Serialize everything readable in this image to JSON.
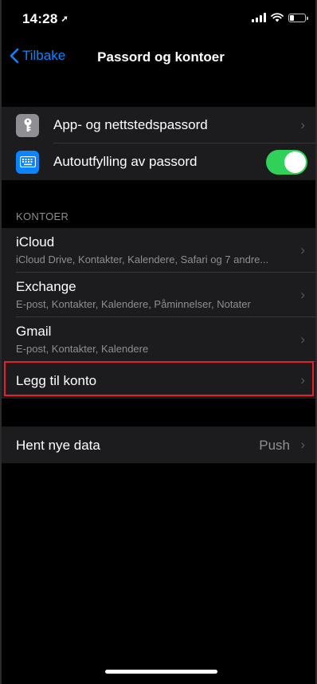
{
  "status": {
    "time": "14:28",
    "location_glyph": "➚"
  },
  "nav": {
    "back_label": "Tilbake",
    "title": "Passord og kontoer"
  },
  "passwords": {
    "app_passwords_label": "App- og nettstedspassord",
    "autofill_label": "Autoutfylling av passord",
    "autofill_on": true
  },
  "accounts": {
    "header": "KONTOER",
    "items": [
      {
        "title": "iCloud",
        "subtitle": "iCloud Drive, Kontakter, Kalendere, Safari og 7 andre..."
      },
      {
        "title": "Exchange",
        "subtitle": "E-post, Kontakter, Kalendere, Påminnelser, Notater"
      },
      {
        "title": "Gmail",
        "subtitle": "E-post, Kontakter, Kalendere"
      }
    ],
    "add_account_label": "Legg til konto"
  },
  "fetch": {
    "label": "Hent nye data",
    "value": "Push"
  },
  "colors": {
    "accent": "#0a84ff",
    "toggle_on": "#30d158",
    "highlight": "#e3202b"
  },
  "icons": {
    "key_icon": "key-icon",
    "keyboard_icon": "keyboard-icon",
    "chevron": "chevron-right-icon"
  }
}
